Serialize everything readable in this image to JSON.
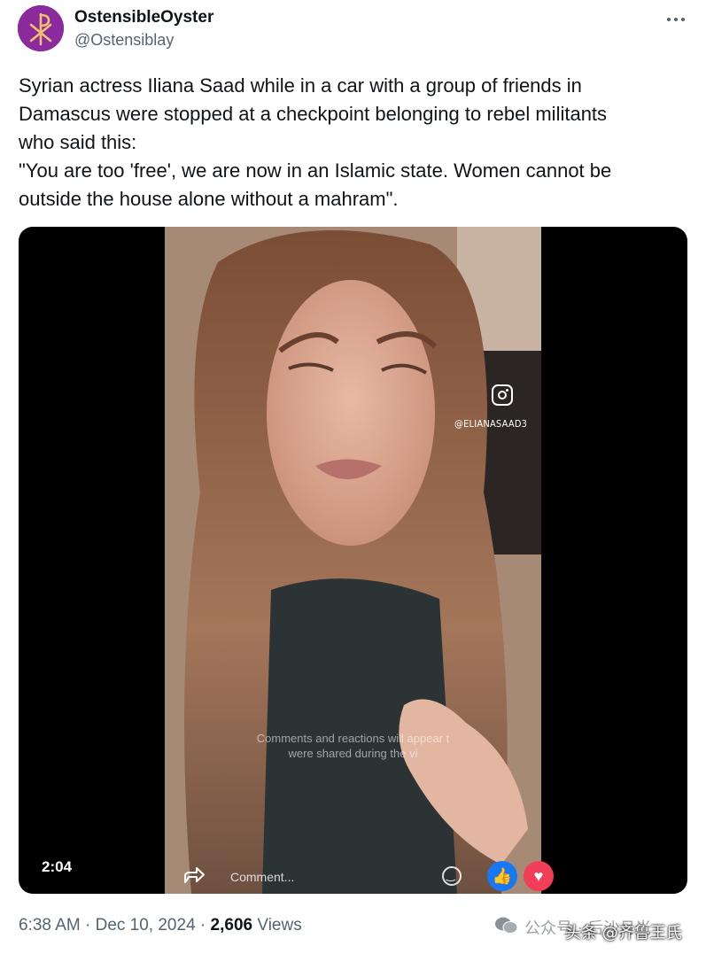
{
  "post": {
    "author": {
      "display_name": "OstensibleOyster",
      "handle": "@Ostensiblay",
      "avatar_color": "#8a2a9c"
    },
    "text": [
      "Syrian actress Iliana Saad while in a car with a group of friends in",
      "Damascus were stopped at a checkpoint belonging to rebel militants",
      "who said this:",
      "\"You are too 'free', we are now in an Islamic state. Women cannot be",
      "outside the house alone without a mahram\"."
    ],
    "more_icon": "more-horizontal-icon",
    "media": {
      "duration": "2:04",
      "overlay_handle": "@ELIANASAAD3",
      "overlay_icon": "instagram-icon",
      "overlay_message": [
        "Comments and reactions will appear t",
        "were shared during the vi"
      ],
      "comment_placeholder": "Comment...",
      "icons": [
        "share-icon",
        "smile-icon",
        "like-icon",
        "love-icon"
      ]
    },
    "meta": {
      "time": "6:38 AM",
      "separator": "·",
      "date": "Dec 10, 2024",
      "views_count": "2,606",
      "views_label": "Views"
    }
  },
  "watermark": {
    "text": "公众号 · 后沙月光",
    "overlay_text": "头条 @齐鲁王氏"
  },
  "colors": {
    "text_primary": "#0f1419",
    "text_secondary": "#536471",
    "like_blue": "#1877f2",
    "love_red": "#f33e58"
  }
}
